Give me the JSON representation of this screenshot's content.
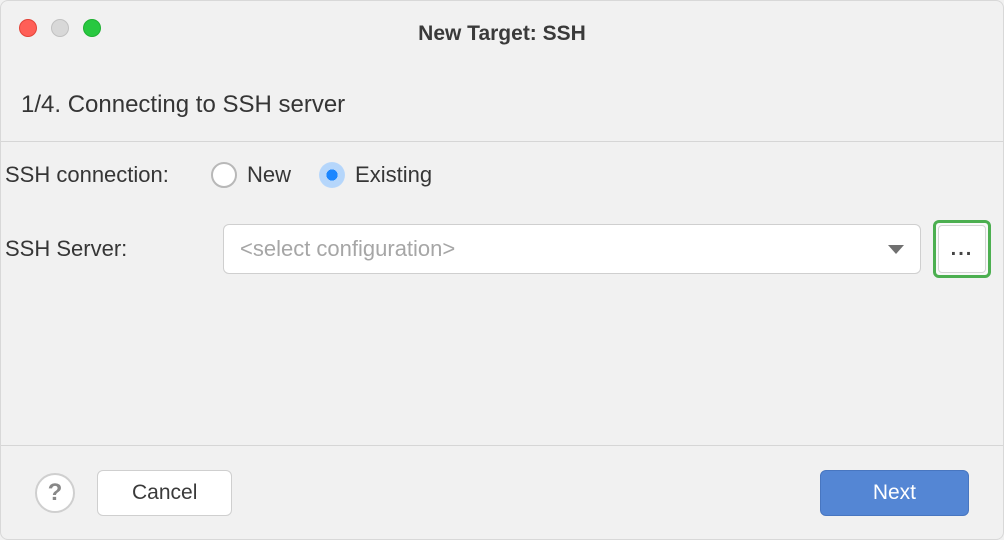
{
  "window": {
    "title": "New Target: SSH"
  },
  "step": {
    "heading": "1/4. Connecting to SSH server"
  },
  "form": {
    "ssh_connection_label": "SSH connection:",
    "radio_new": "New",
    "radio_existing": "Existing",
    "radio_selected": "existing",
    "ssh_server_label": "SSH Server:",
    "ssh_server_placeholder": "<select configuration>",
    "browse_label": "..."
  },
  "footer": {
    "help_label": "?",
    "cancel_label": "Cancel",
    "next_label": "Next"
  }
}
